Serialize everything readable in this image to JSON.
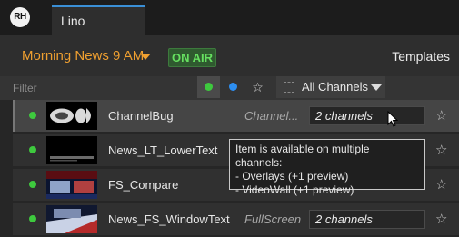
{
  "app": {
    "logo": "RH",
    "tab": "Lino"
  },
  "header": {
    "playlist": "Morning News 9 AM",
    "on_air": "ON AIR",
    "templates": "Templates"
  },
  "filter": {
    "label": "Filter",
    "star": "☆",
    "channels": "All Channels"
  },
  "rows": [
    {
      "name": "ChannelBug",
      "type": "Channel...",
      "channels": "2 channels",
      "fav": "☆"
    },
    {
      "name": "News_LT_LowerText",
      "type": "",
      "channels": "",
      "fav": "☆"
    },
    {
      "name": "FS_Compare",
      "type": "",
      "channels": "",
      "fav": "☆"
    },
    {
      "name": "News_FS_WindowText",
      "type": "FullScreen",
      "channels": "2 channels",
      "fav": "☆"
    }
  ],
  "tooltip": {
    "line1": "Item is available on multiple channels:",
    "line2": "- Overlays (+1 preview)",
    "line3": "- VideoWall (+1 preview)"
  },
  "colors": {
    "accent": "#f0a030",
    "on_air": "#66e060",
    "status_green": "#3ec93e",
    "blue": "#2d8ef0"
  }
}
